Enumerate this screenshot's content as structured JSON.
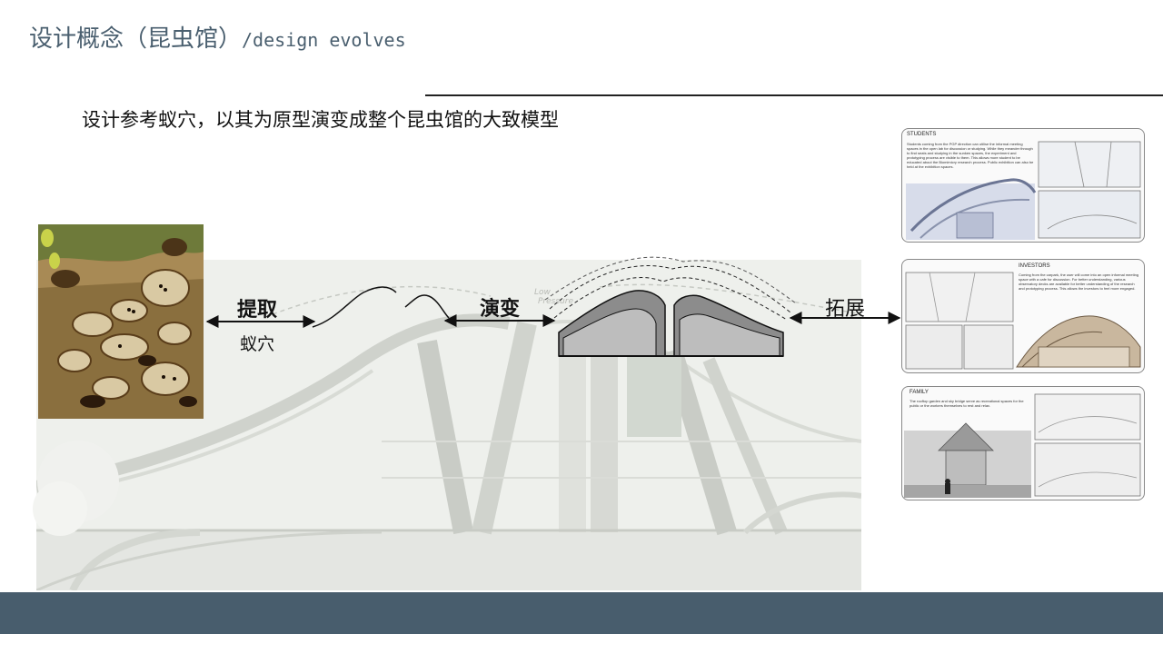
{
  "header": {
    "title_cn": "设计概念（昆虫馆）",
    "title_en": "/design evolves"
  },
  "subtitle": "设计参考蚁穴，以其为原型演变成整个昆虫馆的大致模型",
  "diagram": {
    "extract_label": "提取",
    "nest_label": "蚁穴",
    "evolve_label": "演变",
    "expand_label": "拓展",
    "sketch_note_1": "Low",
    "sketch_note_2": "Pressure"
  },
  "panels": [
    {
      "title": "STUDENTS",
      "text": "Students coming from the PGP direction can utilise the informal meeting spaces in the open lab for discussion or studying. While they meander through to find seats and studying in the sunken spaces, the experiment and prototyping process are visible to them. This allows more student to be educated about the Biomimicry research process. Public exhibition can also be held at the exhibition spaces."
    },
    {
      "title": "INVESTORS",
      "text": "Coming from the carpark, the user will come into an open informal meeting space with a cafe for discussion. For better understanding, various observatory decks are available for better understanding of the research and prototyping process. This allows the investors to feel more engaged."
    },
    {
      "title": "FAMILY",
      "text": "The rooftop garden and sky bridge serve as recreational spaces for the public or the workers themselves to rest and relax."
    }
  ],
  "colors": {
    "title": "#4a5f6f",
    "footer": "#485d6d",
    "section_tone": "#e6e8e3"
  }
}
